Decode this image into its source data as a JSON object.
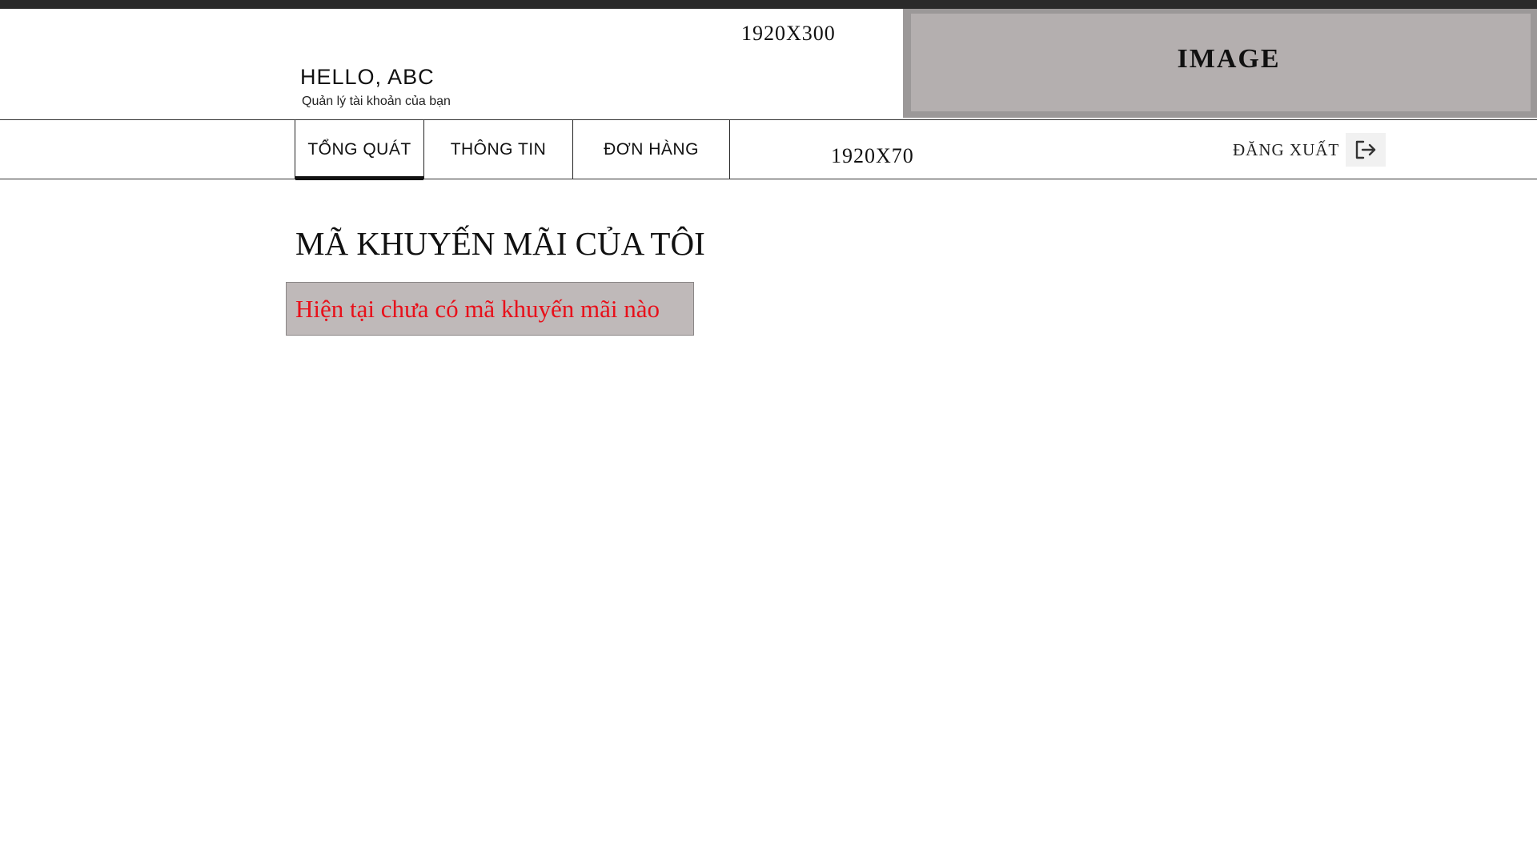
{
  "header": {
    "size_label": "1920X300",
    "greeting": "HELLO, ABC",
    "subtitle": "Quản lý tài khoản của bạn",
    "image_label": "IMAGE"
  },
  "nav": {
    "tabs": [
      {
        "label": "TỔNG QUÁT",
        "active": true
      },
      {
        "label": "THÔNG TIN",
        "active": false
      },
      {
        "label": "ĐƠN HÀNG",
        "active": false
      }
    ],
    "size_label": "1920X70",
    "logout_label": "ĐĂNG XUẤT",
    "logout_icon": "logout-icon"
  },
  "main": {
    "title": "MÃ KHUYẾN MÃI CỦA TÔI",
    "empty_message": "Hiện tại chưa có mã khuyến mãi nào"
  },
  "colors": {
    "topbar": "#2a2a2a",
    "image_placeholder": "#b4afaf",
    "empty_box": "#bfb9b9",
    "empty_text": "#e8101a"
  }
}
